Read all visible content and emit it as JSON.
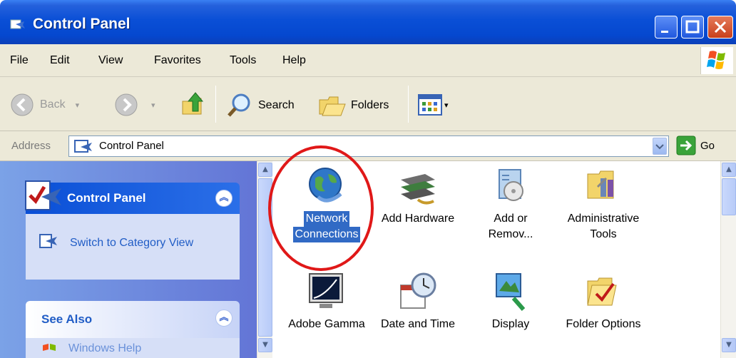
{
  "window": {
    "title": "Control Panel",
    "title_icon": "control-panel-icon",
    "accent": "#0a4fd6"
  },
  "menu": {
    "items": [
      "File",
      "Edit",
      "View",
      "Favorites",
      "Tools",
      "Help"
    ]
  },
  "toolbar": {
    "back_label": "Back",
    "search_label": "Search",
    "folders_label": "Folders"
  },
  "address": {
    "label": "Address",
    "value": "Control Panel",
    "go_label": "Go"
  },
  "taskpane": {
    "panel1_title": "Control Panel",
    "switch_label": "Switch to Category View",
    "panel2_title": "See Also",
    "help_label": "Windows Help"
  },
  "items": [
    {
      "label_l1": "Network",
      "label_l2": "Connections",
      "icon": "network-connections-icon",
      "selected": true
    },
    {
      "label_l1": "Add Hardware",
      "label_l2": "",
      "icon": "add-hardware-icon"
    },
    {
      "label_l1": "Add or",
      "label_l2": "Remov...",
      "icon": "add-remove-programs-icon"
    },
    {
      "label_l1": "Administrative",
      "label_l2": "Tools",
      "icon": "administrative-tools-icon"
    },
    {
      "label_l1": "Adobe Gamma",
      "label_l2": "",
      "icon": "adobe-gamma-icon"
    },
    {
      "label_l1": "Date and Time",
      "label_l2": "",
      "icon": "date-time-icon"
    },
    {
      "label_l1": "Display",
      "label_l2": "",
      "icon": "display-icon"
    },
    {
      "label_l1": "Folder Options",
      "label_l2": "",
      "icon": "folder-options-icon"
    }
  ],
  "annotation": {
    "color": "#e01818"
  }
}
